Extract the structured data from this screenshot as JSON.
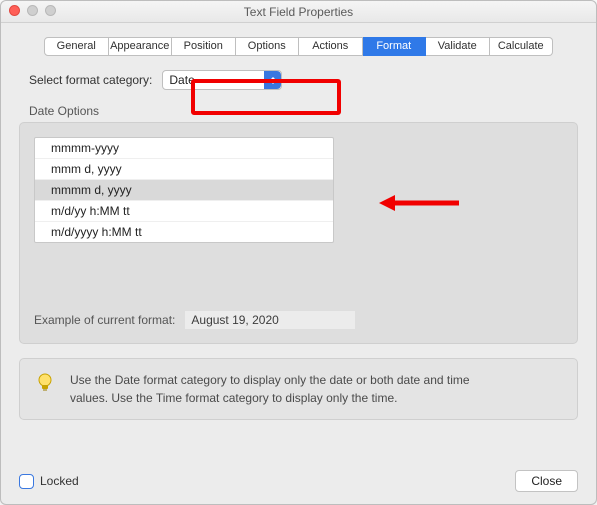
{
  "window": {
    "title": "Text Field Properties"
  },
  "tabs": {
    "general": "General",
    "appearance": "Appearance",
    "position": "Position",
    "options": "Options",
    "actions": "Actions",
    "format": "Format",
    "validate": "Validate",
    "calculate": "Calculate"
  },
  "format": {
    "select_label": "Select format category:",
    "selected_value": "Date",
    "group_title": "Date Options",
    "items": [
      "mmmm-yyyy",
      "mmm d, yyyy",
      "mmmm d, yyyy",
      "m/d/yy h:MM tt",
      "m/d/yyyy h:MM tt"
    ],
    "selected_index": 2,
    "example_label": "Example of current format:",
    "example_value": "August 19, 2020",
    "hint": "Use the Date format category to display only the date or both date and time values. Use the Time format category to display only the time."
  },
  "footer": {
    "locked_label": "Locked",
    "close_label": "Close"
  }
}
